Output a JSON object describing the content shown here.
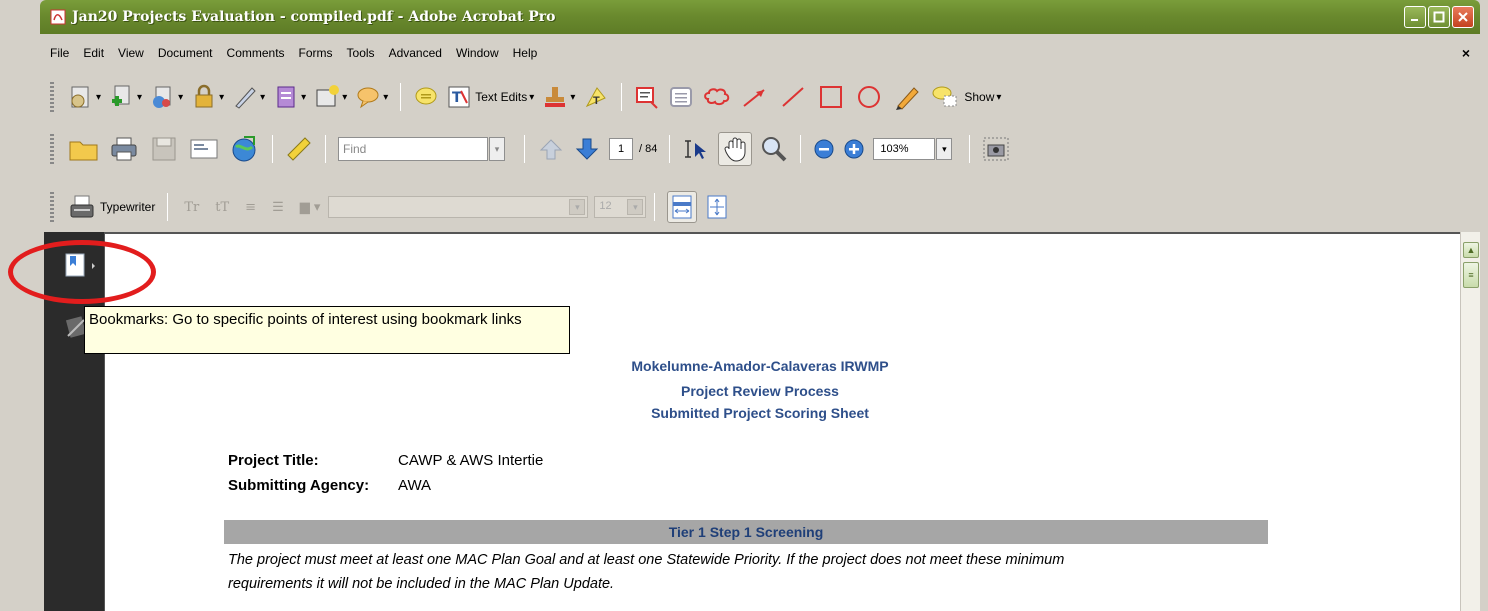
{
  "window": {
    "title": "Jan20 Projects Evaluation - compiled.pdf - Adobe Acrobat Pro"
  },
  "menu": {
    "items": [
      {
        "label": "File"
      },
      {
        "label": "Edit"
      },
      {
        "label": "View"
      },
      {
        "label": "Document"
      },
      {
        "label": "Comments"
      },
      {
        "label": "Forms"
      },
      {
        "label": "Tools"
      },
      {
        "label": "Advanced"
      },
      {
        "label": "Window"
      },
      {
        "label": "Help"
      }
    ],
    "close_doc": "×"
  },
  "toolbar1": {
    "text_edits_label": "Text Edits",
    "show_label": "Show"
  },
  "toolbar2": {
    "find_placeholder": "Find",
    "page_current": "1",
    "page_total": "/ 84",
    "zoom_value": "103%"
  },
  "toolbar3": {
    "typewriter_label": "Typewriter",
    "font_size": "12"
  },
  "tooltip": {
    "text": "Bookmarks: Go to specific points of interest using bookmark links"
  },
  "document": {
    "heading1": "Mokelumne-Amador-Calaveras IRWMP",
    "heading2": "Project Review Process",
    "heading3": "Submitted Project Scoring Sheet",
    "project_title_label": "Project Title:",
    "project_title_value": "CAWP & AWS Intertie",
    "agency_label": "Submitting Agency:",
    "agency_value": "AWA",
    "tier_heading": "Tier 1 Step 1 Screening",
    "body_line1": "The project must meet at least one MAC Plan Goal and at least one Statewide Priority. If the project does not meet these minimum",
    "body_line2": "requirements it will not be included in the MAC Plan Update."
  },
  "colors": {
    "titlebar": "#6a8a2e",
    "heading_blue": "#2e4f8a",
    "annotation_red": "#e21d1d",
    "tooltip_bg": "#ffffe1"
  }
}
